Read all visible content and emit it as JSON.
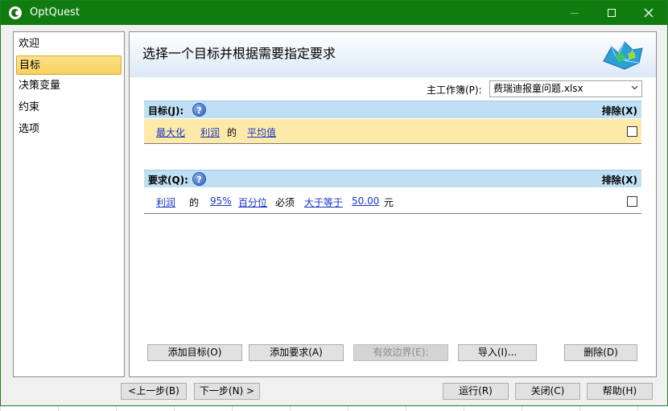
{
  "window": {
    "title": "OptQuest"
  },
  "nav": {
    "items": [
      {
        "label": "欢迎"
      },
      {
        "label": "目标"
      },
      {
        "label": "决策变量"
      },
      {
        "label": "约束"
      },
      {
        "label": "选项"
      }
    ]
  },
  "main": {
    "title": "选择一个目标并根据需要指定要求",
    "workbook_label": "主工作簿(P):",
    "workbook_value": "费瑞迪报童问题.xlsx",
    "objective": {
      "header": "目标(J):",
      "exclude": "排除(X)",
      "row": {
        "goal": "最大化",
        "variable": "利润",
        "of": "的",
        "statistic": "平均值",
        "excluded": false
      }
    },
    "requirements": {
      "header": "要求(Q):",
      "exclude": "排除(X)",
      "row": {
        "variable": "利润",
        "of": "的",
        "percent": "95%",
        "statistic": "百分位",
        "must": "必须",
        "comparison": "大于等于",
        "value": "50.00",
        "unit": "元",
        "excluded": false
      }
    },
    "buttons": {
      "add_objective": "添加目标(O)",
      "add_requirement": "添加要求(A)",
      "efficient_frontier": "有效边界(E):",
      "import": "导入(I)...",
      "delete": "删除(D)"
    }
  },
  "footer": {
    "back": "<上一步(B)",
    "next": "下一步(N) >",
    "run": "运行(R)",
    "close": "关闭(C)",
    "help": "帮助(H)"
  },
  "colors": {
    "titlebar": "#107c10",
    "nav_active": "#f8d05e",
    "section_header": "#bfe0f4",
    "objective_row": "#fdeaa8",
    "link": "#1a35c4"
  }
}
